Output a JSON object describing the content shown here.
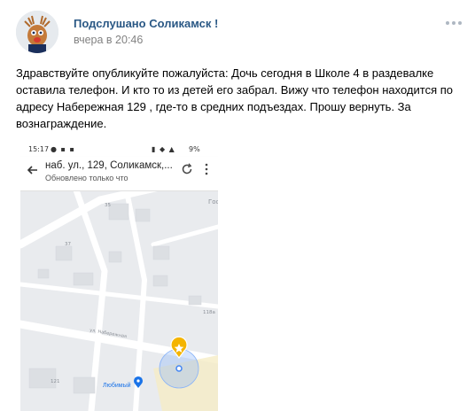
{
  "post": {
    "group_name": "Подслушано Соликамск !",
    "time": "вчера в 20:46",
    "text": "Здравствуйте опубликуйте пожалуйста: Дочь сегодня в Школе 4 в раздевалке оставила телефон. И кто то из детей его забрал. Вижу что телефон находится по адресу Набережная 129 , где-то в средних подъездах. Прошу вернуть. За вознаграждение."
  },
  "screenshot": {
    "status_time": "15:17",
    "battery": "9%",
    "address_title": "наб. ул., 129, Соликамск,...",
    "address_sub": "Обновлено только что",
    "map_labels": {
      "corner": "Гос",
      "n35": "35",
      "n37": "37",
      "n118a": "118а",
      "street": "ул. Набережная",
      "n121": "121",
      "poi": "Любимый"
    }
  },
  "colors": {
    "link": "#2a5885",
    "muted": "#828282",
    "map_bg": "#e9ebee",
    "road": "#ffffff",
    "building": "#dcdfe3",
    "accuracy_circle": "#8ab4f8",
    "pin": "#f4b400",
    "poi": "#1a73e8"
  }
}
